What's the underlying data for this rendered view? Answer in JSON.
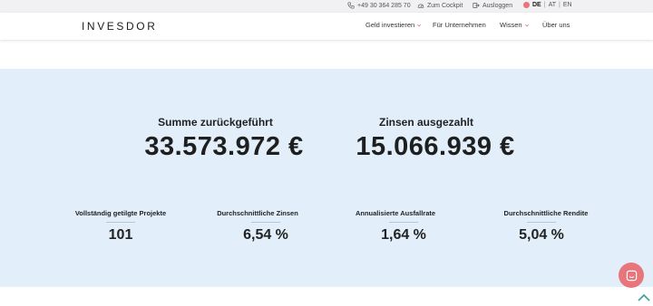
{
  "topbar": {
    "phone": "+49 30 364 285 70",
    "cockpit": "Zum Cockpit",
    "logout": "Ausloggen",
    "languages": [
      "DE",
      "AT",
      "EN"
    ],
    "active_language": "DE"
  },
  "nav": {
    "logo": "INVESDOR",
    "items": [
      {
        "label": "Geld investieren",
        "dropdown": true
      },
      {
        "label": "Für Unternehmen",
        "dropdown": false
      },
      {
        "label": "Wissen",
        "dropdown": true
      },
      {
        "label": "Über uns",
        "dropdown": false
      }
    ]
  },
  "stats": {
    "main": [
      {
        "label": "Summe zurückgeführt",
        "value": "33.573.972 €"
      },
      {
        "label": "Zinsen ausgezahlt",
        "value": "15.066.939 €"
      }
    ],
    "secondary": [
      {
        "label": "Vollständig getilgte Projekte",
        "value": "101"
      },
      {
        "label": "Durchschnittliche Zinsen",
        "value": "6,54 %"
      },
      {
        "label": "Annualisierte Ausfallrate",
        "value": "1,64 %"
      },
      {
        "label": "Durchschnittliche Rendite",
        "value": "5,04 %"
      }
    ]
  },
  "colors": {
    "band_background": "#e2effa",
    "accent": "#e8747c",
    "topbar_background": "#f1f1f3"
  },
  "icons": {
    "phone": "phone-icon",
    "cockpit": "cockpit-icon",
    "logout": "logout-icon",
    "flag": "flag-icon",
    "chat": "chat-icon",
    "scroll": "chevron-up-icon"
  }
}
